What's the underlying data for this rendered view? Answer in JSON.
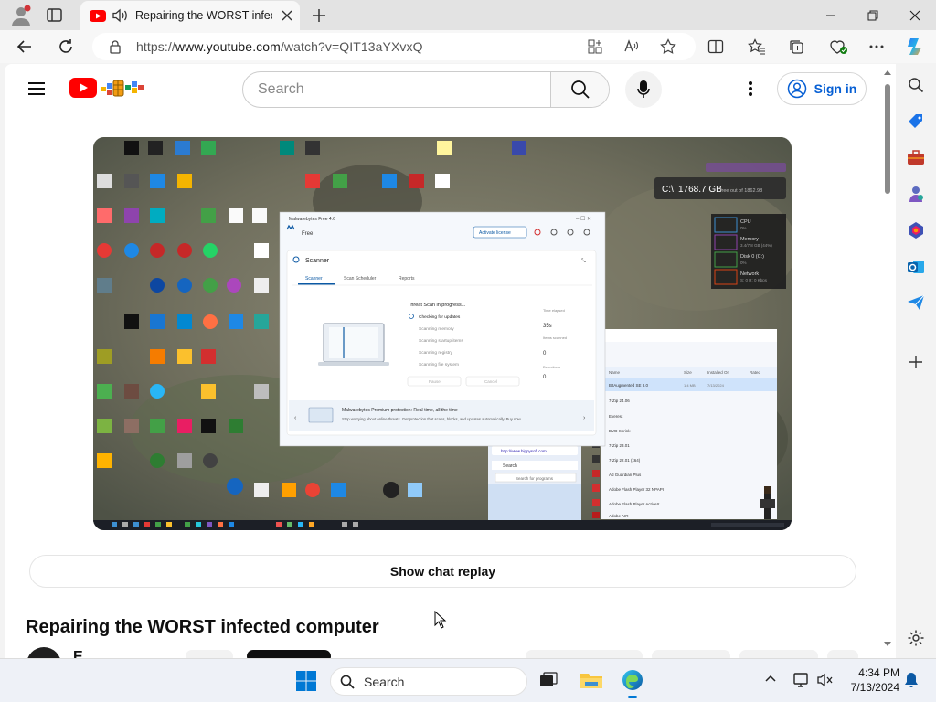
{
  "browser": {
    "tab_title": "Repairing the WORST infect",
    "url_prefix": "https://",
    "url_host": "www.youtube.com",
    "url_path": "/watch?v=QIT13aYXvxQ"
  },
  "youtube": {
    "search_placeholder": "Search",
    "signin_label": "Sign in",
    "chat_replay_label": "Show chat replay",
    "video_title": "Repairing the WORST infected computer",
    "channel_initial": "E"
  },
  "video_frame": {
    "malwarebytes_app": "Malwarebytes Free 4.6",
    "plan": "Free",
    "activate_label": "Activate license",
    "scanner_title": "Scanner",
    "tabs": [
      "Scanner",
      "Scan Scheduler",
      "Reports"
    ],
    "scan_heading": "Threat Scan in progress...",
    "scan_steps": [
      "Checking for updates",
      "Scanning memory",
      "Scanning startup items",
      "Scanning registry",
      "Scanning file system"
    ],
    "stats": [
      {
        "label": "Time elapsed",
        "value": "35s"
      },
      {
        "label": "Items scanned",
        "value": "0"
      },
      {
        "label": "Detections",
        "value": "0"
      }
    ],
    "buttons": [
      "Pause",
      "Cancel"
    ],
    "promo_title": "Malwarebytes Premium protection: Real-time, all the time",
    "promo_text": "Stop worrying about online threats. Get protection that scans, blocks, and updates automatically. Buy now.",
    "disk_label": "C:\\",
    "disk_free": "1768.7 GB",
    "disk_suffix": "free out of 1862.98",
    "perf": [
      {
        "name": "CPU",
        "value": "0%"
      },
      {
        "name": "Memory",
        "value": "3.4/7.8 GB (44%)"
      },
      {
        "name": "Disk 0 (C:)",
        "value": "0%"
      },
      {
        "name": "Network",
        "value": "S: 0 R: 0 Kbps"
      }
    ],
    "browser_url": "http://www.hippysoft.com",
    "browser_search": "Search",
    "browser_search_hint": "Search for programs",
    "programs_header": [
      "Name",
      "Size",
      "Installed On",
      "Rated"
    ],
    "programs": [
      "BitAugmented SE 8.0",
      "7-Zip 24.06",
      "Everest",
      "DVD Shrink",
      "7-Zip 23.01",
      "7-Zip 22.01 (x64)",
      "Ad Guardian Plus",
      "Adobe Flash Player 32 NPAPI",
      "Adobe Flash Player ActiveX",
      "Adobe AIR"
    ]
  },
  "taskbar": {
    "search_placeholder": "Search",
    "time": "4:34 PM",
    "date": "7/13/2024"
  },
  "colors": {
    "youtube_red": "#ff0000",
    "signin_blue": "#065fd4",
    "edge_accent": "#0c59a4"
  }
}
